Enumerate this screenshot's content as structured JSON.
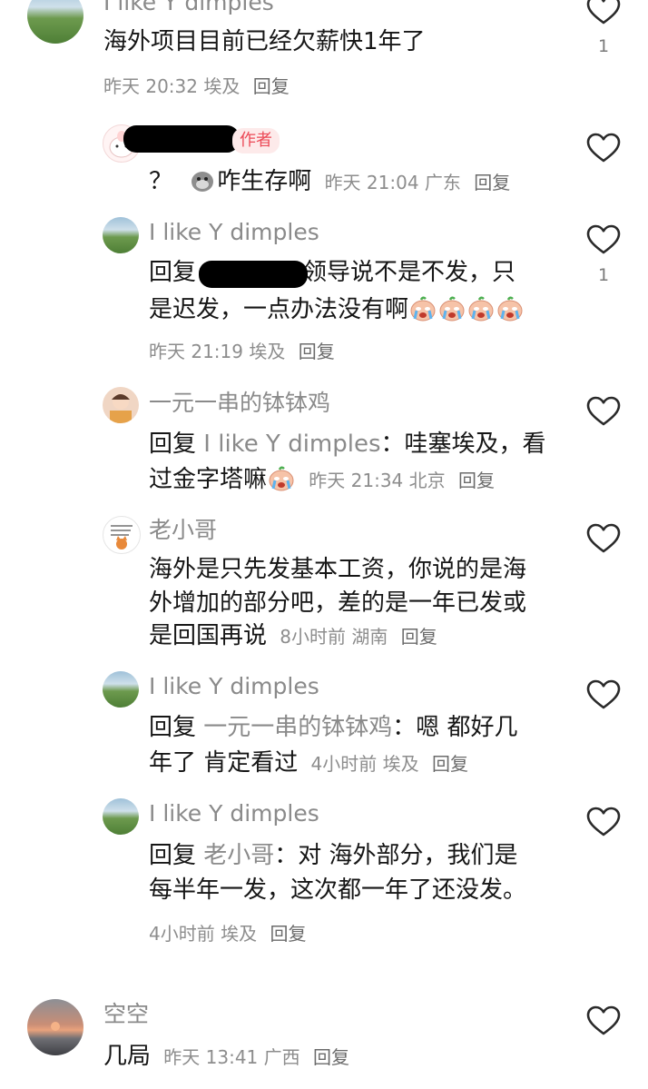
{
  "comments": [
    {
      "user": "I like Y dimples",
      "text": "海外项目目前已经欠薪快1年了",
      "time": "昨天 20:32",
      "location": "埃及",
      "reply_label": "回复",
      "likes": "1"
    },
    {
      "user": "",
      "author_tag": "作者",
      "text_prefix": "？",
      "text": "咋生存啊",
      "time": "昨天 21:04",
      "location": "广东",
      "reply_label": "回复"
    },
    {
      "user": "I like Y dimples",
      "reply_prefix": "回复",
      "text_line1": "领导说不是不发，只",
      "text_line2": "是迟发，一点办法没有啊",
      "time": "昨天 21:19",
      "location": "埃及",
      "reply_label": "回复",
      "likes": "1"
    },
    {
      "user": "一元一串的钵钵鸡",
      "reply_prefix": "回复",
      "reply_target": "I like Y dimples",
      "text_line1": "：哇塞埃及，看",
      "text_line2": "过金字塔嘛",
      "time": "昨天 21:34",
      "location": "北京",
      "reply_label": "回复"
    },
    {
      "user": "老小哥",
      "text_line1": "海外是只先发基本工资，你说的是海",
      "text_line2": "外增加的部分吧，差的是一年已发或",
      "text_line3": "是回国再说",
      "time": "8小时前",
      "location": "湖南",
      "reply_label": "回复"
    },
    {
      "user": "I like Y dimples",
      "reply_prefix": "回复",
      "reply_target": "一元一串的钵钵鸡",
      "text_line1": "：嗯 都好几",
      "text_line2": "年了 肯定看过",
      "time": "4小时前",
      "location": "埃及",
      "reply_label": "回复"
    },
    {
      "user": "I like Y dimples",
      "reply_prefix": "回复",
      "reply_target": "老小哥",
      "text_line1": "：对 海外部分，我们是",
      "text_line2": "每半年一发，这次都一年了还没发。",
      "time": "4小时前",
      "location": "埃及",
      "reply_label": "回复"
    },
    {
      "user": "空空",
      "text": "几局",
      "time": "昨天 13:41",
      "location": "广西",
      "reply_label": "回复"
    }
  ],
  "colors": {
    "author_tag": "#ec4a57",
    "meta": "#8d8d8d",
    "name": "#8a8a8a"
  },
  "icons": [
    "heart-outline-icon",
    "crying-emoji-icon",
    "dog-emoji-icon"
  ]
}
